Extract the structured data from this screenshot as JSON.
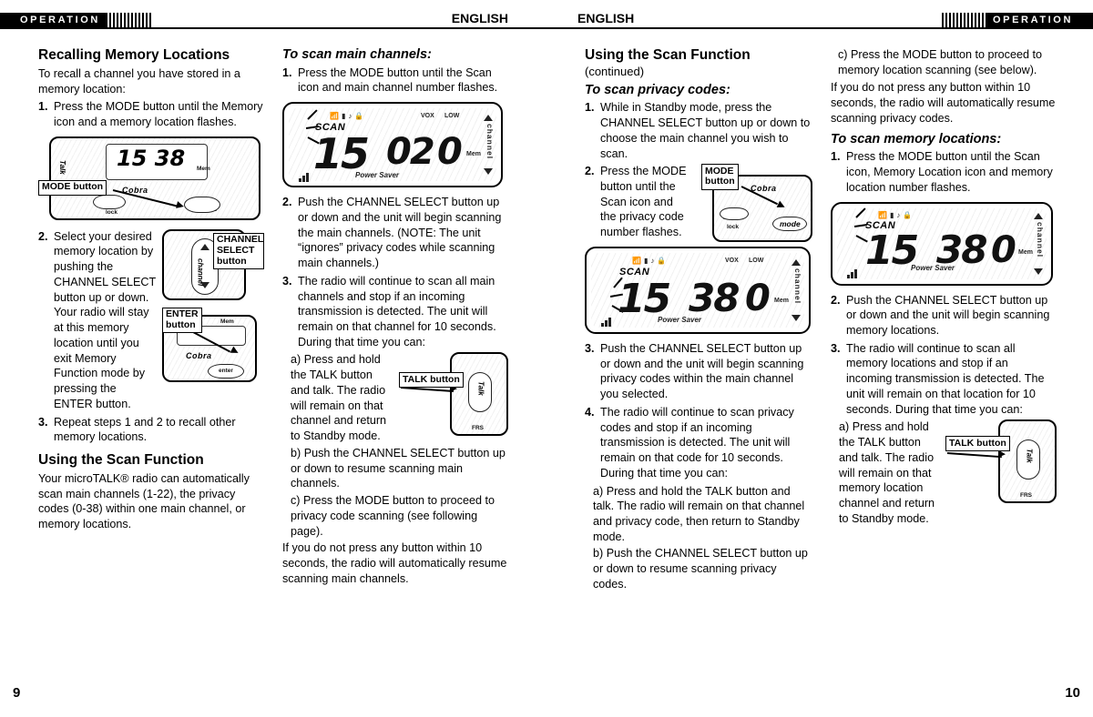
{
  "doc": {
    "left_header": {
      "tab": "OPERATION",
      "lang": "ENGLISH",
      "page_number": "9"
    },
    "right_header": {
      "tab": "OPERATION",
      "lang": "ENGLISH",
      "page_number": "10"
    }
  },
  "left": {
    "col1": {
      "heading": "Recalling Memory Locations",
      "intro": "To recall a channel you have stored in a memory location:",
      "steps": [
        {
          "num": "1.",
          "text": "Press the MODE button until the Memory icon and a memory location flashes."
        },
        {
          "num": "2.",
          "text": "Select your desired memory location by pushing the CHANNEL SELECT button up or down. Your radio will stay at this memory location until you exit Memory Function mode by pressing the ENTER button."
        },
        {
          "num": "3.",
          "text": "Repeat steps 1 and 2 to recall other memory locations."
        }
      ],
      "heading2": "Using the Scan Function",
      "para2": "Your microTALK® radio can automatically scan main channels (1-22), the privacy codes (0-38) within one main channel, or memory locations.",
      "callouts": {
        "mode": "MODE button",
        "channel_select": "CHANNEL\nSELECT\nbutton",
        "enter": "ENTER\nbutton"
      }
    },
    "col2": {
      "heading": "To scan main channels:",
      "steps": [
        {
          "num": "1.",
          "text": "Press the MODE button until the Scan icon and main channel number flashes."
        },
        {
          "num": "2.",
          "text": "Push the CHANNEL SELECT button up or down and the unit will begin scanning the main channels. (NOTE: The unit “ignores” privacy codes while scanning main channels.)"
        },
        {
          "num": "3.",
          "text": "The radio will continue to scan all main channels and stop if an incoming transmission is detected. The unit will remain on that channel for 10 seconds. During that time you can:"
        }
      ],
      "step2_note_label": "NOTE:",
      "sublist": [
        "a) Press and hold the TALK button and talk. The radio will remain on that channel and return to Standby mode.",
        "b) Push the CHANNEL SELECT button up or down to resume scanning main channels.",
        "c) Press the MODE button to proceed to privacy code scanning (see following page)."
      ],
      "closing": "If you do not press any button within 10 seconds, the radio will automatically resume scanning main channels.",
      "callouts": {
        "talk": "TALK button"
      },
      "lcd": {
        "scan_word": "SCAN",
        "main_number": "15",
        "code_number": "02",
        "code_suffix": "0",
        "right_label": "channel",
        "power_saver": "Power Saver",
        "mem_label": "Mem",
        "vox_label": "VOX",
        "low_label": "LOW"
      }
    }
  },
  "right": {
    "col1": {
      "heading": "Using the Scan Function",
      "heading_continued": "(continued)",
      "subheading": "To scan privacy codes:",
      "steps": [
        {
          "num": "1.",
          "text": "While in Standby mode, press the CHANNEL SELECT button up or down to choose the main channel you wish to scan."
        },
        {
          "num": "2.",
          "text": "Press the MODE button until the Scan icon and the privacy code number flashes."
        },
        {
          "num": "3.",
          "text": "Push the CHANNEL SELECT button up or down and the unit will begin scanning privacy codes within the main channel you selected."
        },
        {
          "num": "4.",
          "text": "The radio will continue to scan privacy codes and stop if an incoming transmission is detected. The unit will remain on that code for 10 seconds. During that time you can:"
        }
      ],
      "sublist": [
        "a) Press and hold the TALK button and talk. The radio will remain on that channel and privacy code, then return to Standby mode.",
        "b) Push the CHANNEL SELECT button up or down to resume scanning privacy codes."
      ],
      "callouts": {
        "mode": "MODE\nbutton"
      },
      "lcd": {
        "scan_word": "SCAN",
        "main_number": "15",
        "code_number": "38",
        "code_suffix": "0",
        "right_label": "channel",
        "power_saver": "Power Saver",
        "mem_label": "Mem",
        "vox_label": "VOX",
        "low_label": "LOW"
      }
    },
    "col2": {
      "top_sub": "c) Press the MODE button to proceed to memory location scanning (see below).",
      "para1": "If you do not press any button within 10 seconds, the radio will automatically resume scanning privacy codes.",
      "subheading": "To scan memory locations:",
      "steps": [
        {
          "num": "1.",
          "text": "Press the MODE button until the Scan icon, Memory Location icon and memory location number flashes."
        },
        {
          "num": "2.",
          "text": "Push the CHANNEL SELECT button up or down and the unit will begin scanning memory locations."
        },
        {
          "num": "3.",
          "text": "The radio will continue to scan all memory locations and stop if an incoming transmission is detected. The unit will remain on that location for 10 seconds. During that time you can:"
        }
      ],
      "sublist": [
        "a) Press and hold the TALK button and talk. The radio will remain on that memory location channel and return to Standby mode."
      ],
      "callouts": {
        "talk": "TALK button"
      },
      "lcd": {
        "scan_word": "SCAN",
        "main_number": "15",
        "code_number": "38",
        "code_suffix": "0",
        "right_label": "channel",
        "power_saver": "Power Saver",
        "mem_label": "Mem"
      }
    }
  }
}
